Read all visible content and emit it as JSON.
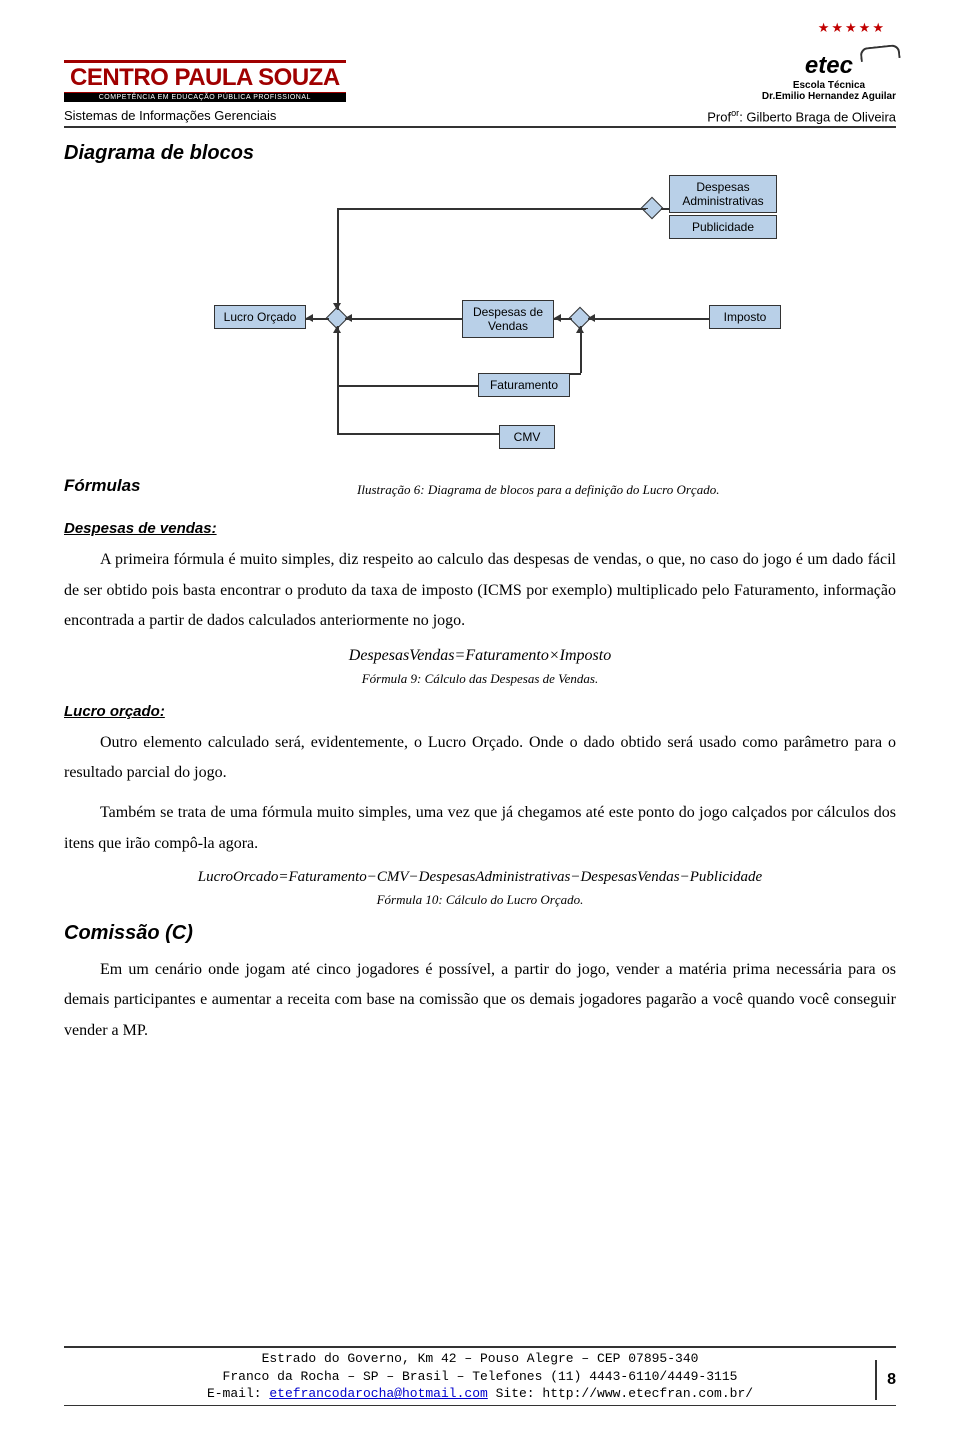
{
  "header": {
    "cps_title": "CENTRO PAULA SOUZA",
    "cps_sub": "COMPETÊNCIA EM EDUCAÇÃO PÚBLICA PROFISSIONAL",
    "etec": "etec",
    "etec_sub": "Escola Técnica",
    "etec_dr": "Dr.Emilio Hernandez Aguilar",
    "stars": "★★★★★",
    "course": "Sistemas de Informações Gerenciais",
    "prof_label": "Prof",
    "prof_sup": "or",
    "prof_name": ": Gilberto Braga de Oliveira"
  },
  "sections": {
    "diagrama_title": "Diagrama de blocos",
    "formulas_title": "Fórmulas",
    "despesas_title": "Despesas de vendas:",
    "lucro_title": "Lucro orçado:",
    "comissao_title": "Comissão (C)"
  },
  "diagram": {
    "lucro_orcado": "Lucro Orçado",
    "despesas_vendas": "Despesas de Vendas",
    "faturamento": "Faturamento",
    "cmv": "CMV",
    "imposto": "Imposto",
    "despesas_admin": "Despesas Administrativas",
    "publicidade": "Publicidade",
    "caption": "Ilustração 6: Diagrama de blocos para a definição do Lucro Orçado."
  },
  "paragraphs": {
    "p1": "A primeira fórmula é muito simples, diz respeito ao calculo das despesas de vendas, o que, no caso do jogo é um dado fácil de ser obtido pois basta encontrar o produto da taxa de imposto (ICMS por exemplo) multiplicado pelo Faturamento, informação encontrada a partir de dados calculados anteriormente no jogo.",
    "p2": "Outro elemento calculado será, evidentemente, o Lucro Orçado. Onde o dado obtido será usado como parâmetro para o resultado parcial do jogo.",
    "p3": "Também se trata de uma fórmula muito simples, uma vez que já chegamos até este ponto do jogo calçados por cálculos dos itens que irão compô-la agora.",
    "p4": "Em um cenário onde jogam até cinco jogadores é possível, a partir do jogo, vender a matéria prima necessária para os demais participantes e aumentar a receita com base na comissão que os demais jogadores pagarão a você quando você conseguir vender a MP."
  },
  "formulas": {
    "f9": "DespesasVendas=Faturamento×Imposto",
    "f9_caption": "Fórmula 9: Cálculo das Despesas de Vendas.",
    "f10": "LucroOrcado=Faturamento−CMV−DespesasAdministrativas−DespesasVendas−Publicidade",
    "f10_caption": "Fórmula 10: Cálculo do Lucro Orçado."
  },
  "footer": {
    "l1": "Estrado do Governo, Km 42 – Pouso Alegre – CEP 07895-340",
    "l2a": "Franco da Rocha – SP – Brasil – Telefones (11) 4443-6110/4449-3115",
    "l3a": "E-mail: ",
    "l3_link": "etefrancodarocha@hotmail.com",
    "l3b": " Site: http://www.etecfran.com.br/",
    "page": "8"
  }
}
